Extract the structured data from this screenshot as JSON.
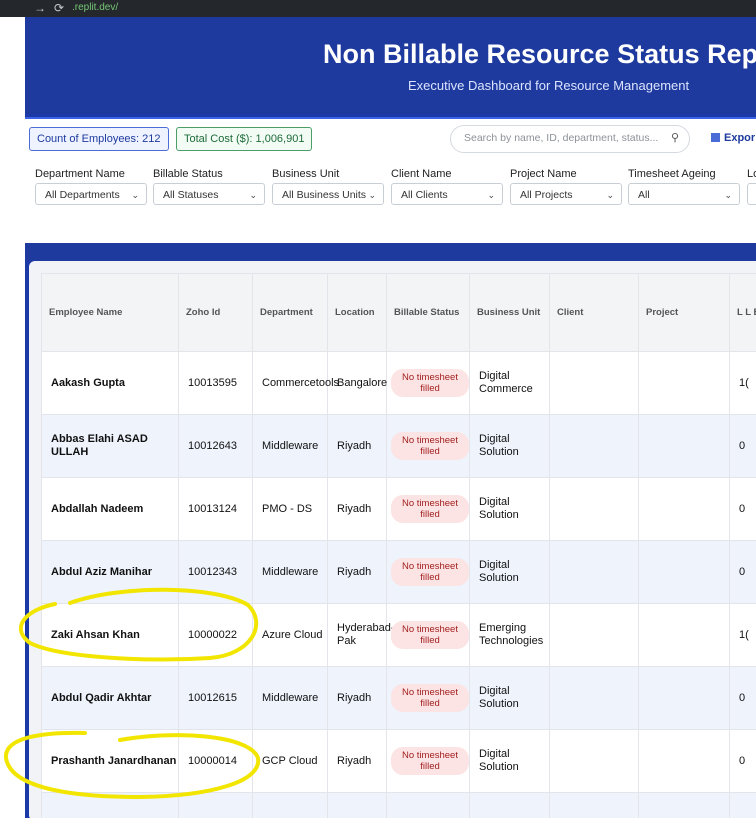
{
  "browser": {
    "nav_back": "→",
    "nav_reload": "⟳",
    "url": ".replit.dev/"
  },
  "header": {
    "title": "Non Billable Resource Status Repo",
    "subtitle": "Executive Dashboard for Resource Management"
  },
  "toolbar": {
    "employee_count": "Count of Employees: 212",
    "total_cost": "Total Cost ($): 1,006,901",
    "search_placeholder": "Search by name, ID, department, status...",
    "export_label": "Expor"
  },
  "filters": [
    {
      "label": "Department Name",
      "value": "All Departments"
    },
    {
      "label": "Billable Status",
      "value": "All Statuses"
    },
    {
      "label": "Business Unit",
      "value": "All Business Units"
    },
    {
      "label": "Client Name",
      "value": "All Clients"
    },
    {
      "label": "Project Name",
      "value": "All Projects"
    },
    {
      "label": "Timesheet Ageing",
      "value": "All"
    },
    {
      "label": "Lo",
      "value": ""
    }
  ],
  "table": {
    "columns": [
      "Employee Name",
      "Zoho Id",
      "Department",
      "Location",
      "Billable Status",
      "Business Unit",
      "Client",
      "Project",
      "L L B"
    ],
    "rows": [
      {
        "name": "Aakash Gupta",
        "zoho": "10013595",
        "dept": "Commercetools",
        "loc": "Bangalore",
        "status": "No timesheet filled",
        "bu": "Digital Commerce",
        "client": "",
        "project": "",
        "last": "1("
      },
      {
        "name": "Abbas Elahi ASAD ULLAH",
        "zoho": "10012643",
        "dept": "Middleware",
        "loc": "Riyadh",
        "status": "No timesheet filled",
        "bu": "Digital Solution",
        "client": "",
        "project": "",
        "last": "0"
      },
      {
        "name": "Abdallah Nadeem",
        "zoho": "10013124",
        "dept": "PMO - DS",
        "loc": "Riyadh",
        "status": "No timesheet filled",
        "bu": "Digital Solution",
        "client": "",
        "project": "",
        "last": "0"
      },
      {
        "name": "Abdul Aziz Manihar",
        "zoho": "10012343",
        "dept": "Middleware",
        "loc": "Riyadh",
        "status": "No timesheet filled",
        "bu": "Digital Solution",
        "client": "",
        "project": "",
        "last": "0"
      },
      {
        "name": "Zaki Ahsan Khan",
        "zoho": "10000022",
        "dept": "Azure Cloud",
        "loc": "Hyderabad-Pak",
        "status": "No timesheet filled",
        "bu": "Emerging Technologies",
        "client": "",
        "project": "",
        "last": "1("
      },
      {
        "name": "Abdul Qadir Akhtar",
        "zoho": "10012615",
        "dept": "Middleware",
        "loc": "Riyadh",
        "status": "No timesheet filled",
        "bu": "Digital Solution",
        "client": "",
        "project": "",
        "last": "0"
      },
      {
        "name": "Prashanth Janardhanan",
        "zoho": "10000014",
        "dept": "GCP Cloud",
        "loc": "Riyadh",
        "status": "No timesheet filled",
        "bu": "Digital Solution",
        "client": "",
        "project": "",
        "last": "0"
      },
      {
        "name": "",
        "zoho": "",
        "dept": "",
        "loc": "",
        "status": "",
        "bu": "",
        "client": "",
        "project": "",
        "last": ""
      }
    ]
  },
  "colors": {
    "header_bg": "#1e3a9e",
    "badge_bg": "#fde4e4",
    "badge_text": "#a21f1f",
    "highlight_marker": "#f2e600"
  }
}
